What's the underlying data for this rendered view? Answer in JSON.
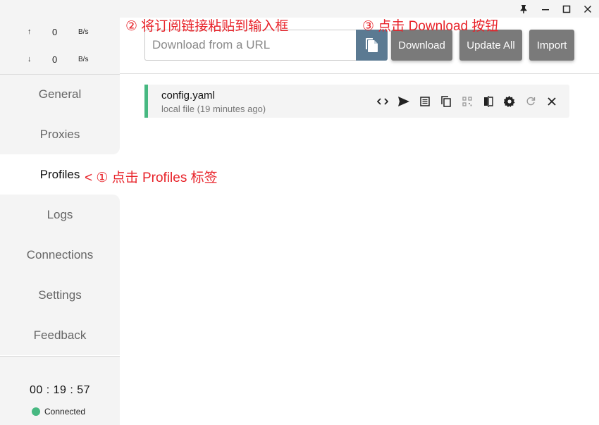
{
  "window": {
    "pin_icon": "pin-icon",
    "minimize_icon": "minimize-icon",
    "maximize_icon": "maximize-icon",
    "close_icon": "close-icon"
  },
  "speed": {
    "up_arrow": "↑",
    "up_value": "0",
    "up_unit": "B/s",
    "down_arrow": "↓",
    "down_value": "0",
    "down_unit": "B/s"
  },
  "nav": {
    "items": [
      {
        "label": "General"
      },
      {
        "label": "Proxies"
      },
      {
        "label": "Profiles"
      },
      {
        "label": "Logs"
      },
      {
        "label": "Connections"
      },
      {
        "label": "Settings"
      },
      {
        "label": "Feedback"
      }
    ],
    "active": "Profiles"
  },
  "status": {
    "clock": "00 : 19 : 57",
    "connection": "Connected",
    "connected_color": "#47b881"
  },
  "toolbar": {
    "url_placeholder": "Download from a URL",
    "download_label": "Download",
    "update_all_label": "Update All",
    "import_label": "Import"
  },
  "profiles": [
    {
      "name": "config.yaml",
      "meta": "local file (19 minutes ago)",
      "actions": [
        "code-icon",
        "send-icon",
        "list-icon",
        "copy-icon",
        "qrcode-icon",
        "compare-icon",
        "gear-icon",
        "refresh-icon",
        "close-icon"
      ]
    }
  ],
  "annotations": {
    "step1": "< ① 点击 Profiles 标签",
    "step2": "② 将订阅链接粘贴到输入框",
    "step3": "③ 点击 Download 按钮",
    "color": "#e8232a"
  }
}
